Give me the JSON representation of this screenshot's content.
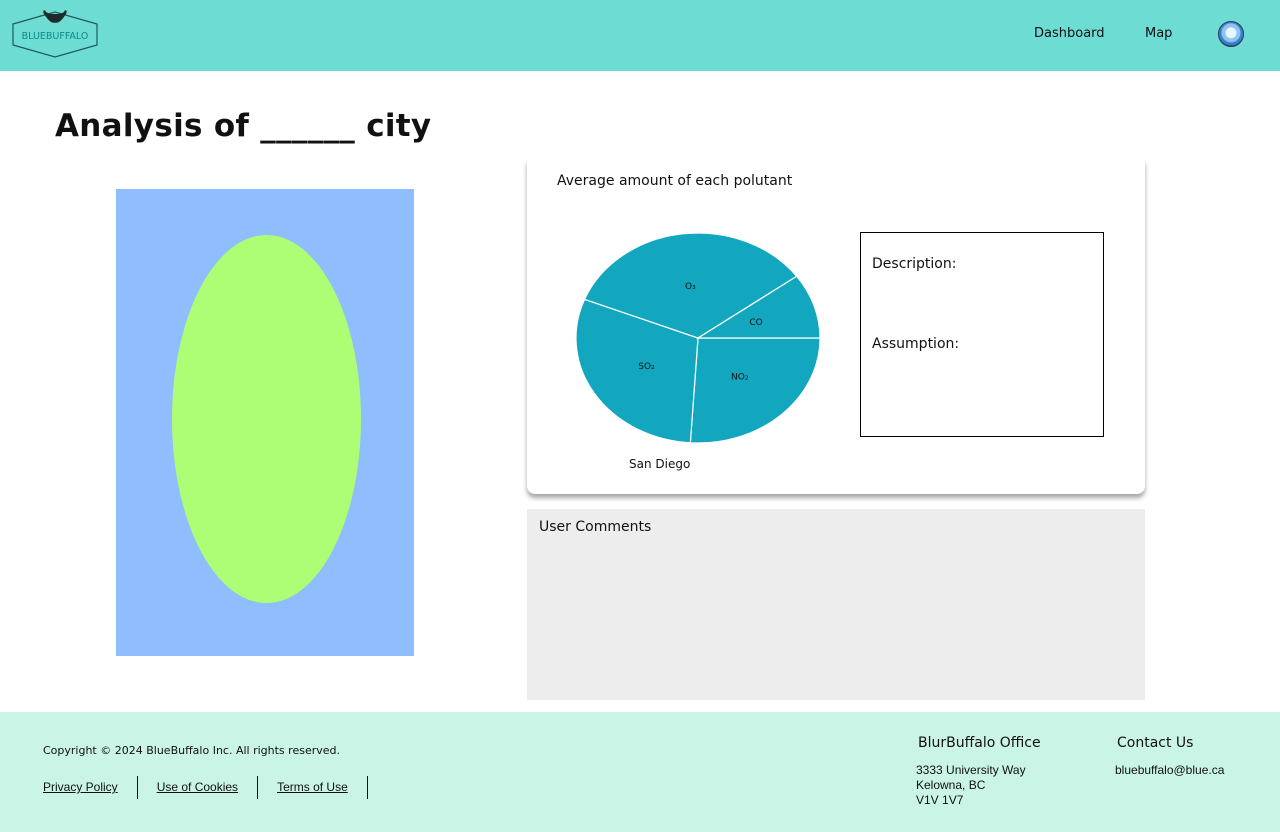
{
  "header": {
    "logo_text": "BLUEBUFFALO",
    "nav": {
      "dashboard": "Dashboard",
      "map": "Map"
    }
  },
  "page": {
    "title": "Analysis of ______ city"
  },
  "chart_card": {
    "title": "Average amount of each polutant",
    "caption": "San Diego",
    "description_label": "Description:",
    "assumption_label": "Assumption:"
  },
  "chart_data": {
    "type": "pie",
    "title": "Average amount of each polutant",
    "categories": [
      "NO₂",
      "SO₂",
      "O₃",
      "CO"
    ],
    "values": [
      26,
      30,
      34,
      10
    ],
    "colors": {
      "fill": "#12a7bf",
      "border": "#ffffff"
    }
  },
  "comments": {
    "title": "User Comments"
  },
  "footer": {
    "copyright": "Copyright © 2024 BlueBuffalo Inc. All rights reserved.",
    "links": [
      "Privacy Policy",
      "Use of Cookies",
      "Terms of Use"
    ],
    "office": {
      "title": "BlurBuffalo Office",
      "lines": [
        "3333 University Way",
        "Kelowna, BC",
        "V1V 1V7"
      ]
    },
    "contact": {
      "title": "Contact Us",
      "email": "bluebuffalo@blue.ca"
    }
  },
  "colors": {
    "header_bg": "#6ddcd3",
    "footer_bg": "#caf4e6",
    "image_bg": "#90bdfd",
    "ellipse": "#adfe74",
    "comments_bg": "#ededed"
  },
  "icons": {
    "logo": "buffalo-logo-icon",
    "avatar": "user-avatar-icon"
  }
}
